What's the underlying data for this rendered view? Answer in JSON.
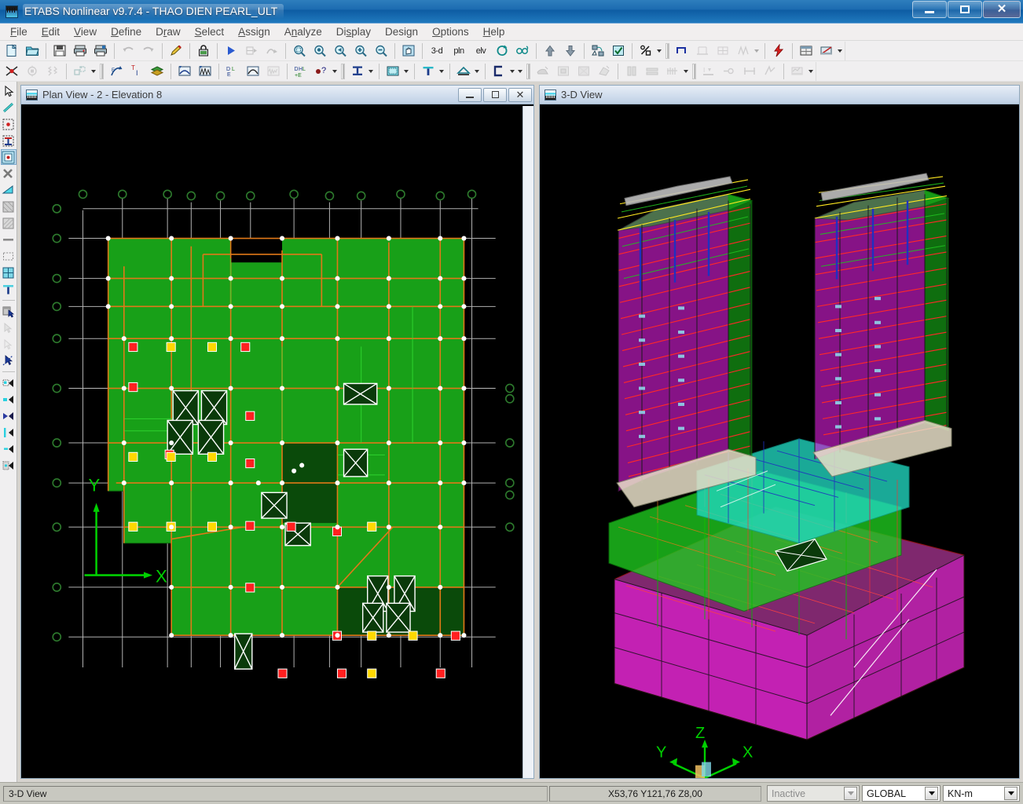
{
  "window": {
    "title": "ETABS Nonlinear v9.7.4 - THAO DIEN PEARL_ULT",
    "minimize_label": "–",
    "maximize_label": "□",
    "close_label": "✕"
  },
  "menubar": {
    "items": [
      {
        "label": "File",
        "mnemonic": "F"
      },
      {
        "label": "Edit",
        "mnemonic": "E"
      },
      {
        "label": "View",
        "mnemonic": "V"
      },
      {
        "label": "Define",
        "mnemonic": "D"
      },
      {
        "label": "Draw",
        "mnemonic": "r"
      },
      {
        "label": "Select",
        "mnemonic": "S"
      },
      {
        "label": "Assign",
        "mnemonic": "A"
      },
      {
        "label": "Analyze",
        "mnemonic": "n"
      },
      {
        "label": "Display",
        "mnemonic": "s"
      },
      {
        "label": "Design",
        "mnemonic": "g"
      },
      {
        "label": "Options",
        "mnemonic": "O"
      },
      {
        "label": "Help",
        "mnemonic": "H"
      }
    ]
  },
  "toolbar_row1": {
    "items": [
      {
        "name": "new-model-icon",
        "kind": "icon",
        "glyph": "new",
        "enabled": true
      },
      {
        "name": "open-file-icon",
        "kind": "icon",
        "glyph": "open",
        "enabled": true
      },
      {
        "name": "separator",
        "kind": "sep"
      },
      {
        "name": "save-icon",
        "kind": "icon",
        "glyph": "save",
        "enabled": true
      },
      {
        "name": "print-graphics-icon",
        "kind": "icon",
        "glyph": "print",
        "enabled": true
      },
      {
        "name": "print-tables-icon",
        "kind": "icon",
        "glyph": "print2",
        "enabled": true
      },
      {
        "name": "separator",
        "kind": "sep"
      },
      {
        "name": "undo-icon",
        "kind": "icon",
        "glyph": "undo",
        "enabled": false
      },
      {
        "name": "redo-icon",
        "kind": "icon",
        "glyph": "redo",
        "enabled": false
      },
      {
        "name": "separator",
        "kind": "sep"
      },
      {
        "name": "edit-pencil-icon",
        "kind": "icon",
        "glyph": "pencil",
        "enabled": true
      },
      {
        "name": "separator",
        "kind": "sep"
      },
      {
        "name": "lock-model-icon",
        "kind": "icon",
        "glyph": "lock",
        "enabled": true
      },
      {
        "name": "separator",
        "kind": "sep"
      },
      {
        "name": "run-analysis-icon",
        "kind": "icon",
        "glyph": "runarrow",
        "enabled": true
      },
      {
        "name": "run-static-icon",
        "kind": "icon",
        "glyph": "runstatic",
        "enabled": false
      },
      {
        "name": "run-dynamic-icon",
        "kind": "icon",
        "glyph": "rundyn",
        "enabled": false
      },
      {
        "name": "separator",
        "kind": "sep"
      },
      {
        "name": "rubber-band-zoom-icon",
        "kind": "icon",
        "glyph": "zoombox",
        "enabled": true
      },
      {
        "name": "restore-full-view-icon",
        "kind": "icon",
        "glyph": "zoomfull",
        "enabled": true
      },
      {
        "name": "previous-zoom-icon",
        "kind": "icon",
        "glyph": "zoomprev",
        "enabled": true
      },
      {
        "name": "zoom-in-icon",
        "kind": "icon",
        "glyph": "zoomin",
        "enabled": true
      },
      {
        "name": "zoom-out-icon",
        "kind": "icon",
        "glyph": "zoomout",
        "enabled": true
      },
      {
        "name": "separator",
        "kind": "sep"
      },
      {
        "name": "pan-hand-icon",
        "kind": "icon",
        "glyph": "pan",
        "enabled": true
      },
      {
        "name": "separator",
        "kind": "sep"
      },
      {
        "name": "view-3d-button",
        "kind": "text",
        "label": "3-d",
        "enabled": true
      },
      {
        "name": "view-plan-button",
        "kind": "text",
        "label": "pln",
        "enabled": true
      },
      {
        "name": "view-elevation-button",
        "kind": "text",
        "label": "elv",
        "enabled": true
      },
      {
        "name": "rotate-3d-view-icon",
        "kind": "icon",
        "glyph": "rotate",
        "enabled": true
      },
      {
        "name": "perspective-toggle-icon",
        "kind": "icon",
        "glyph": "glasses",
        "enabled": true
      },
      {
        "name": "separator",
        "kind": "sep"
      },
      {
        "name": "move-up-story-icon",
        "kind": "icon",
        "glyph": "arrowup",
        "enabled": true
      },
      {
        "name": "move-down-story-icon",
        "kind": "icon",
        "glyph": "arrowdown",
        "enabled": true
      },
      {
        "name": "separator",
        "kind": "sep"
      },
      {
        "name": "set-elements-icon",
        "kind": "icon",
        "glyph": "setelem",
        "enabled": true
      },
      {
        "name": "set-building-view-icon",
        "kind": "icon",
        "glyph": "checkbox",
        "enabled": true
      },
      {
        "name": "separator",
        "kind": "sep"
      },
      {
        "name": "scale-percent-icon",
        "kind": "icon",
        "glyph": "percent",
        "enabled": true
      },
      {
        "name": "scale-dropdown-arrow",
        "kind": "arrow",
        "enabled": true
      },
      {
        "name": "grip",
        "kind": "grip"
      },
      {
        "name": "draw-area-icon",
        "kind": "icon",
        "glyph": "drawarea",
        "enabled": true
      },
      {
        "name": "draw-frame-icon",
        "kind": "icon",
        "glyph": "drawframe",
        "enabled": false
      },
      {
        "name": "draw-wall-icon",
        "kind": "icon",
        "glyph": "drawwall",
        "enabled": false
      },
      {
        "name": "draw-brace-icon",
        "kind": "icon",
        "glyph": "drawbrace",
        "enabled": false
      },
      {
        "name": "draw-dropdown-arrow",
        "kind": "arrow",
        "enabled": false
      },
      {
        "name": "separator",
        "kind": "sep"
      },
      {
        "name": "quick-draw-icon",
        "kind": "icon",
        "glyph": "bolt",
        "enabled": true
      },
      {
        "name": "separator",
        "kind": "sep"
      },
      {
        "name": "show-table-icon",
        "kind": "icon",
        "glyph": "table",
        "enabled": true
      },
      {
        "name": "section-cut-icon",
        "kind": "icon",
        "glyph": "sectioncut",
        "enabled": true
      },
      {
        "name": "section-dropdown-arrow",
        "kind": "arrow",
        "enabled": true
      }
    ]
  },
  "toolbar_row2": {
    "items": [
      {
        "name": "point-assign-icon",
        "kind": "icon",
        "glyph": "pointx",
        "enabled": true
      },
      {
        "name": "restraint-assign-icon",
        "kind": "icon",
        "glyph": "restraint",
        "enabled": false
      },
      {
        "name": "spring-assign-icon",
        "kind": "icon",
        "glyph": "spring",
        "enabled": false
      },
      {
        "name": "separator",
        "kind": "sep"
      },
      {
        "name": "replicate-icon",
        "kind": "icon",
        "glyph": "replicate",
        "enabled": false
      },
      {
        "name": "replicate-dropdown-arrow",
        "kind": "arrow",
        "enabled": true
      },
      {
        "name": "grip",
        "kind": "grip"
      },
      {
        "name": "display-deformed-icon",
        "kind": "icon",
        "glyph": "deformed",
        "enabled": true
      },
      {
        "name": "display-label-icon",
        "kind": "icon",
        "glyph": "label",
        "enabled": true
      },
      {
        "name": "display-layers-icon",
        "kind": "icon",
        "glyph": "layers",
        "enabled": true
      },
      {
        "name": "separator",
        "kind": "sep"
      },
      {
        "name": "moment-diagram-icon",
        "kind": "icon",
        "glyph": "moment",
        "enabled": true
      },
      {
        "name": "shear-diagram-icon",
        "kind": "icon",
        "glyph": "shear",
        "enabled": true
      },
      {
        "name": "separator",
        "kind": "sep"
      },
      {
        "name": "deformed-shape-icon",
        "kind": "icon",
        "glyph": "dlshape",
        "enabled": true
      },
      {
        "name": "mode-shape-icon",
        "kind": "icon",
        "glyph": "modeshape",
        "enabled": true
      },
      {
        "name": "time-history-icon",
        "kind": "icon",
        "glyph": "history",
        "enabled": false
      },
      {
        "name": "separator",
        "kind": "sep"
      },
      {
        "name": "energy-diagram-icon",
        "kind": "icon",
        "glyph": "energy",
        "enabled": true
      },
      {
        "name": "identify-object-icon",
        "kind": "icon",
        "glyph": "identify",
        "enabled": true
      },
      {
        "name": "identify-dropdown-arrow",
        "kind": "arrow",
        "enabled": true
      },
      {
        "name": "grip",
        "kind": "grip"
      },
      {
        "name": "section-property-icon",
        "kind": "icon",
        "glyph": "ibeam",
        "enabled": true
      },
      {
        "name": "section-dropdown-arrow",
        "kind": "arrow",
        "enabled": true
      },
      {
        "name": "separator",
        "kind": "sep"
      },
      {
        "name": "material-icon",
        "kind": "icon",
        "glyph": "material",
        "enabled": true
      },
      {
        "name": "material-dropdown-arrow",
        "kind": "arrow",
        "enabled": true
      },
      {
        "name": "separator",
        "kind": "sep"
      },
      {
        "name": "tee-section-icon",
        "kind": "icon",
        "glyph": "tee",
        "enabled": true
      },
      {
        "name": "tee-dropdown-arrow",
        "kind": "arrow",
        "enabled": true
      },
      {
        "name": "separator",
        "kind": "sep"
      },
      {
        "name": "truss-section-icon",
        "kind": "icon",
        "glyph": "truss",
        "enabled": true
      },
      {
        "name": "truss-dropdown-arrow",
        "kind": "arrow",
        "enabled": true
      },
      {
        "name": "separator",
        "kind": "sep"
      },
      {
        "name": "channel-section-icon",
        "kind": "icon",
        "glyph": "channel",
        "enabled": true
      },
      {
        "name": "channel-dropdown-arrow",
        "kind": "arrow",
        "enabled": true
      },
      {
        "name": "extra-dropdown-arrow",
        "kind": "arrow",
        "enabled": true
      },
      {
        "name": "grip",
        "kind": "grip"
      },
      {
        "name": "concrete-design-icon",
        "kind": "icon",
        "glyph": "concrete",
        "enabled": false
      },
      {
        "name": "steel-design-icon",
        "kind": "icon",
        "glyph": "steeldes",
        "enabled": false
      },
      {
        "name": "shear-wall-design-icon",
        "kind": "icon",
        "glyph": "walldes",
        "enabled": false
      },
      {
        "name": "composite-design-icon",
        "kind": "icon",
        "glyph": "compdes",
        "enabled": false
      },
      {
        "name": "separator",
        "kind": "sep"
      },
      {
        "name": "column-design-icon",
        "kind": "icon",
        "glyph": "coldes",
        "enabled": false
      },
      {
        "name": "slab-design-icon",
        "kind": "icon",
        "glyph": "slabdes",
        "enabled": false
      },
      {
        "name": "rebar-icon",
        "kind": "icon",
        "glyph": "rebar",
        "enabled": false
      },
      {
        "name": "rebar-dropdown-arrow",
        "kind": "arrow",
        "enabled": true
      },
      {
        "name": "grip",
        "kind": "grip"
      },
      {
        "name": "joint-reaction-icon",
        "kind": "icon",
        "glyph": "reaction",
        "enabled": false
      },
      {
        "name": "support-icon",
        "kind": "icon",
        "glyph": "support",
        "enabled": false
      },
      {
        "name": "span-icon",
        "kind": "icon",
        "glyph": "span",
        "enabled": false
      },
      {
        "name": "dynamic-icon",
        "kind": "icon",
        "glyph": "dynamic",
        "enabled": false
      },
      {
        "name": "separator",
        "kind": "sep"
      },
      {
        "name": "output-table-icon",
        "kind": "icon",
        "glyph": "outtable",
        "enabled": false
      },
      {
        "name": "output-dropdown-arrow",
        "kind": "arrow",
        "enabled": true
      }
    ]
  },
  "left_toolbar": {
    "items": [
      {
        "name": "select-pointer-tool",
        "glyph": "pointer",
        "enabled": true,
        "selected": false
      },
      {
        "name": "draw-line-tool",
        "glyph": "line",
        "enabled": true,
        "selected": false
      },
      {
        "name": "draw-point-tool",
        "glyph": "point",
        "enabled": true,
        "selected": false
      },
      {
        "name": "draw-column-tool",
        "glyph": "column",
        "enabled": true,
        "selected": false
      },
      {
        "name": "draw-beam-tool",
        "glyph": "beam",
        "enabled": true,
        "selected": true
      },
      {
        "name": "draw-brace-tool",
        "glyph": "bracex",
        "enabled": true,
        "selected": false
      },
      {
        "name": "draw-area-tool",
        "glyph": "areatri",
        "enabled": true,
        "selected": false
      },
      {
        "name": "draw-wall-tool",
        "glyph": "wallhatch",
        "enabled": true,
        "selected": false
      },
      {
        "name": "draw-floor-tool",
        "glyph": "floorhatch",
        "enabled": true,
        "selected": false
      },
      {
        "name": "draw-line-object-tool",
        "glyph": "hline",
        "enabled": true,
        "selected": false
      },
      {
        "name": "draw-rect-tool",
        "glyph": "dashrect",
        "enabled": true,
        "selected": false
      },
      {
        "name": "draw-mesh-tool",
        "glyph": "meshgrid",
        "enabled": true,
        "selected": false
      },
      {
        "name": "draw-section-tool",
        "glyph": "teeblue",
        "enabled": true,
        "selected": false
      },
      {
        "name": "separator",
        "glyph": "sep"
      },
      {
        "name": "select-all-tool",
        "glyph": "selall",
        "enabled": true,
        "selected": false
      },
      {
        "name": "select-previous-tool",
        "glyph": "selprev",
        "enabled": false,
        "selected": false
      },
      {
        "name": "clear-selection-tool",
        "glyph": "selclear",
        "enabled": false,
        "selected": false
      },
      {
        "name": "select-intersect-tool",
        "glyph": "selint",
        "enabled": true,
        "selected": false
      },
      {
        "name": "separator",
        "glyph": "sep"
      },
      {
        "name": "snap-endpoint-tool",
        "glyph": "snapend",
        "enabled": true,
        "selected": false
      },
      {
        "name": "snap-midpoint-tool",
        "glyph": "snapmid",
        "enabled": true,
        "selected": false
      },
      {
        "name": "snap-intersection-tool",
        "glyph": "snapint",
        "enabled": true,
        "selected": false
      },
      {
        "name": "snap-perpendicular-tool",
        "glyph": "snapperp",
        "enabled": true,
        "selected": false
      },
      {
        "name": "snap-line-tool",
        "glyph": "snapline",
        "enabled": true,
        "selected": false
      },
      {
        "name": "snap-grid-tool",
        "glyph": "snapgrid",
        "enabled": true,
        "selected": false
      }
    ]
  },
  "plan_window": {
    "title": "Plan View - 2 - Elevation 8",
    "minimize_label": "–",
    "maximize_label": "□",
    "close_label": "✕",
    "axis_x_label": "X",
    "axis_y_label": "Y"
  },
  "view3d_window": {
    "title": "3-D View",
    "axis_x_label": "X",
    "axis_y_label": "Y",
    "axis_z_label": "Z"
  },
  "statusbar": {
    "message": "3-D View",
    "coordinates": "X53,76  Y121,76  Z8,00",
    "analysis_state": "Inactive",
    "coordinate_system": "GLOBAL",
    "units": "KN-m"
  },
  "colors": {
    "slab_green": "#18A018",
    "slab_dark_green": "#0A4A0A",
    "beam_orange": "#E07818",
    "node_red": "#FF2020",
    "node_yellow": "#FFD800",
    "grid_gray": "#B0B0B0",
    "wall_magenta": "#E020E0",
    "wall_green": "#18A018",
    "slab_cyan": "#20E0C0",
    "column_blue": "#2030C0",
    "beam_red": "#FF2020",
    "beam_yellow": "#FFE020",
    "canvas_black": "#000000",
    "axis_green": "#00D000",
    "titlebar_blue": "#1c6bb0"
  }
}
